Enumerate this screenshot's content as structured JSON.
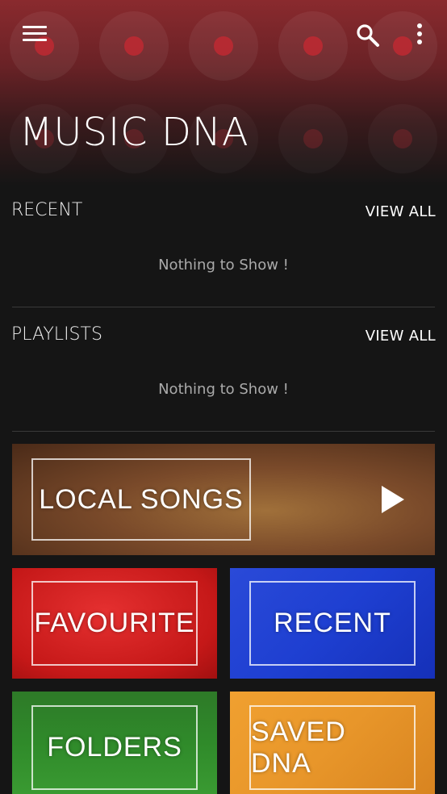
{
  "app": {
    "title": "MUSIC DNA"
  },
  "sections": {
    "recent": {
      "title": "RECENT",
      "view_all": "VIEW ALL",
      "empty": "Nothing to Show !"
    },
    "playlists": {
      "title": "PLAYLISTS",
      "view_all": "VIEW ALL",
      "empty": "Nothing to Show !"
    }
  },
  "tiles": {
    "local_songs": {
      "label": "LOCAL SONGS",
      "color": "#7a4a2a"
    },
    "favourite": {
      "label": "FAVOURITE",
      "color": "#d11e1e"
    },
    "recent": {
      "label": "RECENT",
      "color": "#1e3fd1"
    },
    "folders": {
      "label": "FOLDERS",
      "color": "#2f8a2a"
    },
    "saved_dna": {
      "label": "SAVED DNA",
      "color": "#e8962a"
    }
  },
  "colors": {
    "accent": "#8a2a2e",
    "background": "#151515"
  },
  "icons": [
    "menu-icon",
    "search-icon",
    "more-vert-icon",
    "play-icon"
  ]
}
